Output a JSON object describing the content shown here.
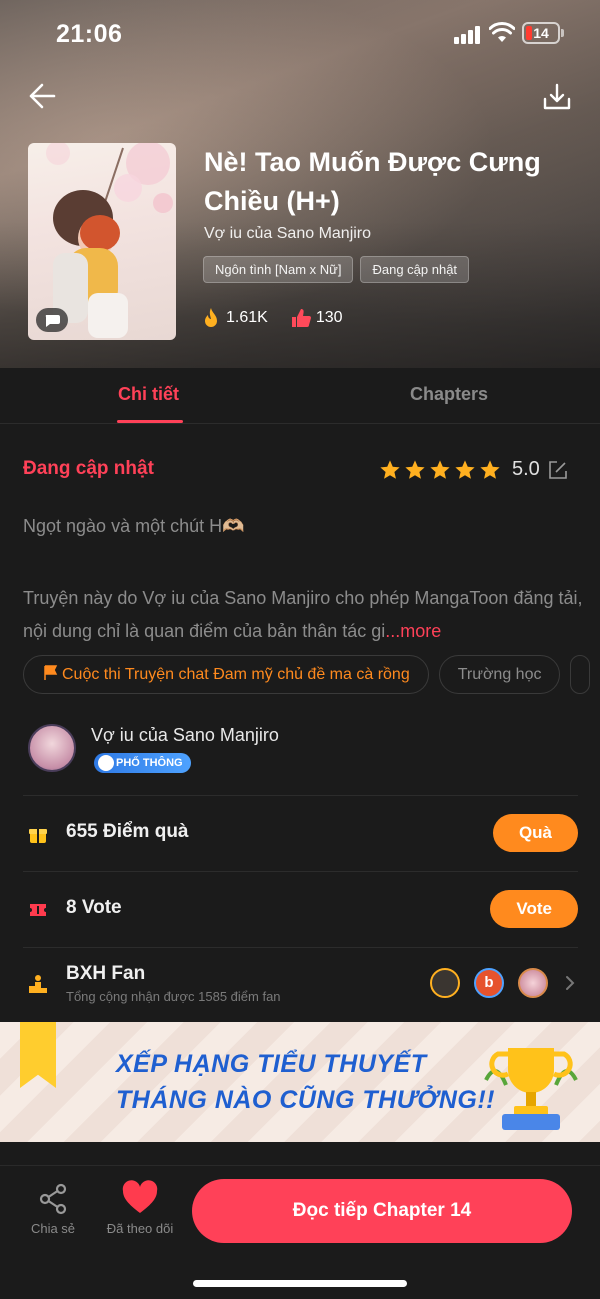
{
  "status_bar": {
    "time": "21:06",
    "battery_level": "14",
    "battery_color": "#ff3b30"
  },
  "header": {
    "back_icon": "arrow-left-icon",
    "download_icon": "download-icon"
  },
  "book": {
    "title": "Nè! Tao Muốn Được Cưng Chiều (H+)",
    "author": "Vợ iu của Sano Manjiro",
    "tags": [
      "Ngôn tình [Nam x Nữ]",
      "Đang cập nhật"
    ],
    "hot_count": "1.61K",
    "like_count": "130"
  },
  "tabs": {
    "detail": "Chi tiết",
    "chapters": "Chapters",
    "active": "detail",
    "accent": "#ff4158"
  },
  "detail": {
    "status": "Đang cập nhật",
    "star_count": 5,
    "rating": "5.0",
    "tagline": "Ngọt ngào và một chút H🫶🏼",
    "description": "Truyện này do Vợ iu của Sano Manjiro cho phép MangaToon đăng tải, nội dung chỉ là quan điểm của bản thân tác gi",
    "more_label": "...more",
    "chips": [
      "Cuộc thi Truyện chat Đam mỹ chủ đề ma cà rồng",
      "Trường học"
    ]
  },
  "author_card": {
    "name": "Vợ iu của Sano Manjiro",
    "badge": "PHỔ THÔNG"
  },
  "gift_row": {
    "text": "655 Điểm quà",
    "button": "Quà",
    "icon": "gift-icon"
  },
  "vote_row": {
    "text": "8 Vote",
    "button": "Vote",
    "icon": "ticket-icon"
  },
  "fan_row": {
    "title": "BXH Fan",
    "subtitle": "Tổng cộng nhận được 1585 điểm fan",
    "icon": "podium-icon"
  },
  "banner": {
    "line1": "XẾP HẠNG TIỂU THUYẾT",
    "line2": "THÁNG NÀO CŨNG THƯỞNG!!"
  },
  "bottom": {
    "share_label": "Chia sẻ",
    "follow_label": "Đã theo dõi",
    "read_button": "Đọc tiếp Chapter 14"
  }
}
